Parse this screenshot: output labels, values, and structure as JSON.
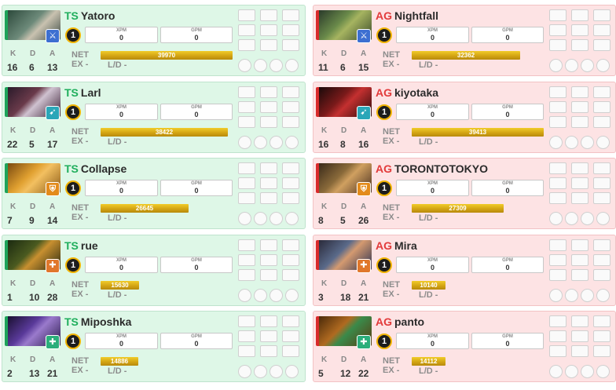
{
  "teams": [
    {
      "tag": "TS",
      "color": "#1fae5c",
      "players": [
        {
          "name": "Yatoro",
          "level": "1",
          "xpm_label": "XPM",
          "xpm": "0",
          "gpm_label": "GPM",
          "gpm": "0",
          "k": "16",
          "d": "6",
          "a": "13",
          "net_label": "NET",
          "net": "39970",
          "net_fraction": 0.99,
          "ex_label": "EX -",
          "ld_label": "L/D -",
          "role_icon": "sword-icon",
          "role_glyph": "⚔",
          "role_color": "#3d6fd1",
          "hero_art": "hero-yatoro-portrait"
        },
        {
          "name": "Larl",
          "level": "1",
          "xpm_label": "XPM",
          "xpm": "0",
          "gpm_label": "GPM",
          "gpm": "0",
          "k": "22",
          "d": "5",
          "a": "17",
          "net_label": "NET",
          "net": "38422",
          "net_fraction": 0.95,
          "ex_label": "EX -",
          "ld_label": "L/D -",
          "role_icon": "bow-icon",
          "role_glyph": "➹",
          "role_color": "#2aa6b8",
          "hero_art": "hero-larl-portrait"
        },
        {
          "name": "Collapse",
          "level": "1",
          "xpm_label": "XPM",
          "xpm": "0",
          "gpm_label": "GPM",
          "gpm": "0",
          "k": "7",
          "d": "9",
          "a": "14",
          "net_label": "NET",
          "net": "26645",
          "net_fraction": 0.66,
          "ex_label": "EX -",
          "ld_label": "L/D -",
          "role_icon": "shield-icon",
          "role_glyph": "⛨",
          "role_color": "#e38b1b",
          "hero_art": "hero-collapse-portrait"
        },
        {
          "name": "rue",
          "level": "1",
          "xpm_label": "XPM",
          "xpm": "0",
          "gpm_label": "GPM",
          "gpm": "0",
          "k": "1",
          "d": "10",
          "a": "28",
          "net_label": "NET",
          "net": "15630",
          "net_fraction": 0.29,
          "ex_label": "EX -",
          "ld_label": "L/D -",
          "role_icon": "support-icon",
          "role_glyph": "✚",
          "role_color": "#e0772b",
          "hero_art": "hero-rue-portrait"
        },
        {
          "name": "Miposhka",
          "level": "1",
          "xpm_label": "XPM",
          "xpm": "0",
          "gpm_label": "GPM",
          "gpm": "0",
          "k": "2",
          "d": "13",
          "a": "21",
          "net_label": "NET",
          "net": "14886",
          "net_fraction": 0.28,
          "ex_label": "EX -",
          "ld_label": "L/D -",
          "role_icon": "hard-support-icon",
          "role_glyph": "✚",
          "role_color": "#2bae7b",
          "hero_art": "hero-miposhka-portrait"
        }
      ]
    },
    {
      "tag": "AG",
      "color": "#e23a3a",
      "players": [
        {
          "name": "Nightfall",
          "level": "1",
          "xpm_label": "XPM",
          "xpm": "0",
          "gpm_label": "GPM",
          "gpm": "0",
          "k": "11",
          "d": "6",
          "a": "15",
          "net_label": "NET",
          "net": "32362",
          "net_fraction": 0.81,
          "ex_label": "EX -",
          "ld_label": "L/D -",
          "role_icon": "sword-icon",
          "role_glyph": "⚔",
          "role_color": "#3d6fd1",
          "hero_art": "hero-nightfall-portrait"
        },
        {
          "name": "kiyotaka",
          "level": "1",
          "xpm_label": "XPM",
          "xpm": "0",
          "gpm_label": "GPM",
          "gpm": "0",
          "k": "16",
          "d": "8",
          "a": "16",
          "net_label": "NET",
          "net": "39413",
          "net_fraction": 0.99,
          "ex_label": "EX -",
          "ld_label": "L/D -",
          "role_icon": "bow-icon",
          "role_glyph": "➹",
          "role_color": "#2aa6b8",
          "hero_art": "hero-kiyotaka-portrait"
        },
        {
          "name": "TORONTOTOKYO",
          "level": "1",
          "xpm_label": "XPM",
          "xpm": "0",
          "gpm_label": "GPM",
          "gpm": "0",
          "k": "8",
          "d": "5",
          "a": "26",
          "net_label": "NET",
          "net": "27309",
          "net_fraction": 0.69,
          "ex_label": "EX -",
          "ld_label": "L/D -",
          "role_icon": "shield-icon",
          "role_glyph": "⛨",
          "role_color": "#e38b1b",
          "hero_art": "hero-torontotokyo-portrait"
        },
        {
          "name": "Mira",
          "level": "1",
          "xpm_label": "XPM",
          "xpm": "0",
          "gpm_label": "GPM",
          "gpm": "0",
          "k": "3",
          "d": "18",
          "a": "21",
          "net_label": "NET",
          "net": "10140",
          "net_fraction": 0.25,
          "ex_label": "EX -",
          "ld_label": "L/D -",
          "role_icon": "support-icon",
          "role_glyph": "✚",
          "role_color": "#e0772b",
          "hero_art": "hero-mira-portrait"
        },
        {
          "name": "panto",
          "level": "1",
          "xpm_label": "XPM",
          "xpm": "0",
          "gpm_label": "GPM",
          "gpm": "0",
          "k": "5",
          "d": "12",
          "a": "22",
          "net_label": "NET",
          "net": "14112",
          "net_fraction": 0.25,
          "ex_label": "EX -",
          "ld_label": "L/D -",
          "role_icon": "hard-support-icon",
          "role_glyph": "✚",
          "role_color": "#2bae7b",
          "hero_art": "hero-panto-portrait"
        }
      ]
    }
  ]
}
